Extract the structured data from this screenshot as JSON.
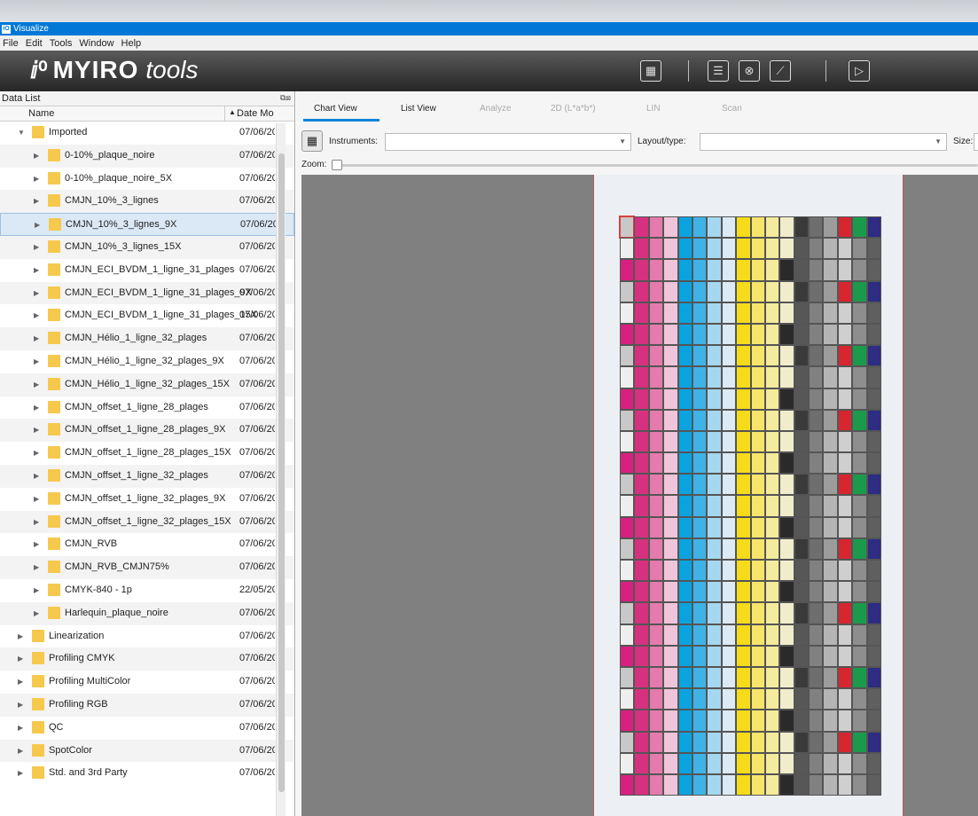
{
  "window": {
    "title": "Visualize",
    "icon": "myiro-app-icon"
  },
  "menu": [
    "File",
    "Edit",
    "Tools",
    "Window",
    "Help"
  ],
  "brand": {
    "name": "MYIRO",
    "suffix": "tools"
  },
  "toolbar_icons": [
    "instrument-icon",
    "list-icon",
    "target-icon",
    "curve-icon",
    "play-icon"
  ],
  "data_list": {
    "title": "Data List",
    "columns": [
      "Name",
      "Date Mo"
    ],
    "rows": [
      {
        "label": "Imported",
        "date": "07/06/20",
        "level": 0,
        "expanded": true
      },
      {
        "label": "0-10%_plaque_noire",
        "date": "07/06/20",
        "level": 1
      },
      {
        "label": "0-10%_plaque_noire_5X",
        "date": "07/06/20",
        "level": 1
      },
      {
        "label": "CMJN_10%_3_lignes",
        "date": "07/06/20",
        "level": 1
      },
      {
        "label": "CMJN_10%_3_lignes_9X",
        "date": "07/06/20",
        "level": 1,
        "selected": true
      },
      {
        "label": "CMJN_10%_3_lignes_15X",
        "date": "07/06/20",
        "level": 1
      },
      {
        "label": "CMJN_ECI_BVDM_1_ligne_31_plages",
        "date": "07/06/20",
        "level": 1
      },
      {
        "label": "CMJN_ECI_BVDM_1_ligne_31_plages_9X",
        "date": "07/06/20",
        "level": 1
      },
      {
        "label": "CMJN_ECI_BVDM_1_ligne_31_plages_15X",
        "date": "07/06/20",
        "level": 1
      },
      {
        "label": "CMJN_Hélio_1_ligne_32_plages",
        "date": "07/06/20",
        "level": 1
      },
      {
        "label": "CMJN_Hélio_1_ligne_32_plages_9X",
        "date": "07/06/20",
        "level": 1
      },
      {
        "label": "CMJN_Hélio_1_ligne_32_plages_15X",
        "date": "07/06/20",
        "level": 1
      },
      {
        "label": "CMJN_offset_1_ligne_28_plages",
        "date": "07/06/20",
        "level": 1
      },
      {
        "label": "CMJN_offset_1_ligne_28_plages_9X",
        "date": "07/06/20",
        "level": 1
      },
      {
        "label": "CMJN_offset_1_ligne_28_plages_15X",
        "date": "07/06/20",
        "level": 1
      },
      {
        "label": "CMJN_offset_1_ligne_32_plages",
        "date": "07/06/20",
        "level": 1
      },
      {
        "label": "CMJN_offset_1_ligne_32_plages_9X",
        "date": "07/06/20",
        "level": 1
      },
      {
        "label": "CMJN_offset_1_ligne_32_plages_15X",
        "date": "07/06/20",
        "level": 1
      },
      {
        "label": "CMJN_RVB",
        "date": "07/06/20",
        "level": 1
      },
      {
        "label": "CMJN_RVB_CMJN75%",
        "date": "07/06/20",
        "level": 1
      },
      {
        "label": "CMYK-840 - 1p",
        "date": "22/05/20",
        "level": 1
      },
      {
        "label": "Harlequin_plaque_noire",
        "date": "07/06/20",
        "level": 1
      },
      {
        "label": "Linearization",
        "date": "07/06/20",
        "level": 0
      },
      {
        "label": "Profiling CMYK",
        "date": "07/06/20",
        "level": 0
      },
      {
        "label": "Profiling MultiColor",
        "date": "07/06/20",
        "level": 0
      },
      {
        "label": "Profiling RGB",
        "date": "07/06/20",
        "level": 0
      },
      {
        "label": "QC",
        "date": "07/06/20",
        "level": 0
      },
      {
        "label": "SpotColor",
        "date": "07/06/20",
        "level": 0
      },
      {
        "label": "Std. and 3rd Party",
        "date": "07/06/20",
        "level": 0
      }
    ]
  },
  "tabs": [
    {
      "label": "Chart View",
      "active": true
    },
    {
      "label": "List View",
      "active": false
    },
    {
      "label": "Analyze",
      "disabled": true
    },
    {
      "label": "2D (L*a*b*)",
      "disabled": true
    },
    {
      "label": "LIN",
      "disabled": true
    },
    {
      "label": "Scan",
      "disabled": true
    }
  ],
  "filters": {
    "instruments_label": "Instruments:",
    "instruments_value": "",
    "layout_label": "Layout/type:",
    "layout_value": "",
    "size_label": "Size:"
  },
  "zoom": {
    "label": "Zoom:",
    "level": 0
  },
  "chart": {
    "columns": 18,
    "rows": 27,
    "row_patterns": [
      [
        "#c8c8c8",
        "#d6317f",
        "#e57aad",
        "#f0c5da",
        "#0aa3e0",
        "#3fb3e6",
        "#a6d7f0",
        "#dde9f3",
        "#f5db1a",
        "#f7e56a",
        "#f4ec9c",
        "#f1edcc",
        "#3a3a3a",
        "#6e6e6e",
        "#9c9c9c",
        "#d7262f",
        "#1b9a4d",
        "#2e2c83"
      ],
      [
        "#eeeeee",
        "#d6317f",
        "#e57aad",
        "#f0c5da",
        "#0aa3e0",
        "#3fb3e6",
        "#a6d7f0",
        "#dde9f3",
        "#f5db1a",
        "#f7e56a",
        "#f4ec9c",
        "#f1edcc",
        "#575757",
        "#818181",
        "#b5b5b5",
        "#cfcfcf",
        "#8e8e8e",
        "#5f5f5f"
      ],
      [
        "#d7207f",
        "#d6317f",
        "#e57aad",
        "#f0c5da",
        "#0aa3e0",
        "#3fb3e6",
        "#a6d7f0",
        "#dde9f3",
        "#f5db1a",
        "#f7e56a",
        "#f4ec9c",
        "#2a2a2a",
        "#575757",
        "#818181",
        "#b5b5b5",
        "#cfcfcf",
        "#8e8e8e",
        "#5f5f5f"
      ]
    ]
  }
}
